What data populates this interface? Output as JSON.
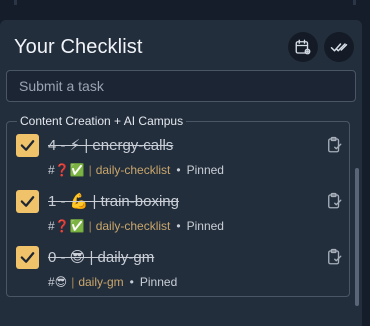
{
  "header": {
    "title": "Your Checklist",
    "schedule_icon": "calendar-gear-icon",
    "complete_all_icon": "double-check-icon"
  },
  "task_input": {
    "placeholder": "Submit a task",
    "value": ""
  },
  "group": {
    "name": "Content Creation + AI Campus",
    "items": [
      {
        "title": "4 - ⚡ | energy-calls",
        "tag": "#❓✅",
        "link": "daily-checklist",
        "status": "Pinned",
        "checked": true
      },
      {
        "title": "1 - 💪 | train-boxing",
        "tag": "#❓✅",
        "link": "daily-checklist",
        "status": "Pinned",
        "checked": true
      },
      {
        "title": "0 - 😎 | daily-gm",
        "tag": "#😎",
        "link": "daily-gm",
        "status": "Pinned",
        "checked": true
      }
    ]
  },
  "colors": {
    "background": "#151d2a",
    "panel": "#232e3d",
    "checkbox": "#f0c36b",
    "link": "#c9a66b"
  }
}
